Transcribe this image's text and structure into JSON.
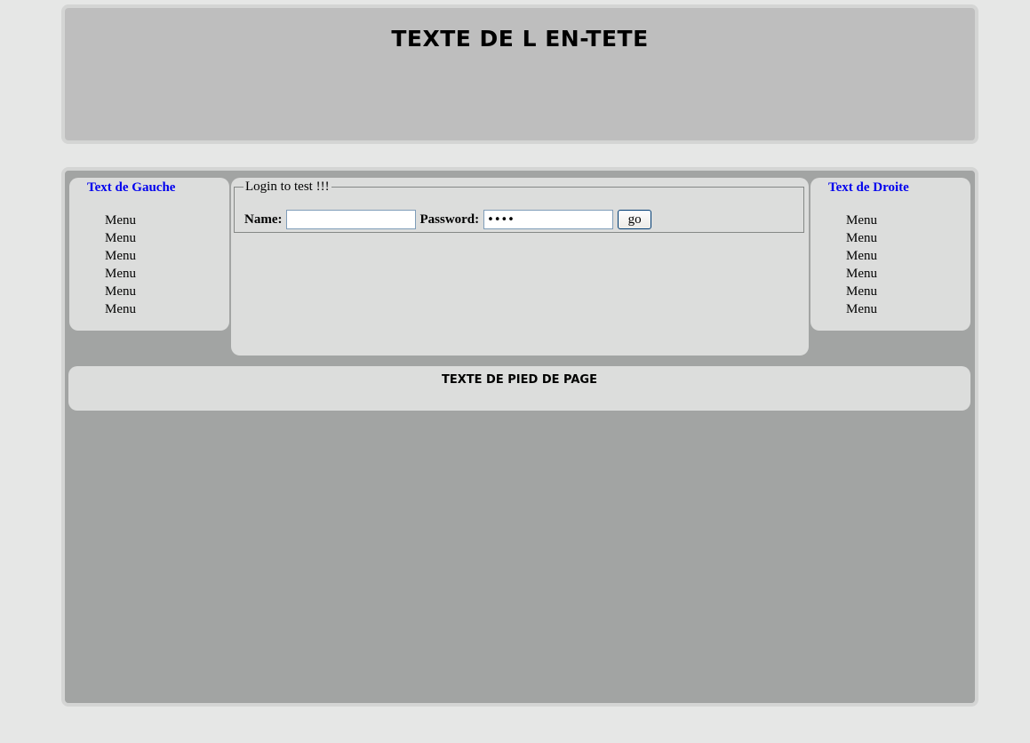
{
  "header": {
    "title": "TEXTE DE L EN-TETE"
  },
  "left_sidebar": {
    "title": "Text de Gauche",
    "items": [
      {
        "label": "Menu"
      },
      {
        "label": "Menu"
      },
      {
        "label": "Menu"
      },
      {
        "label": "Menu"
      },
      {
        "label": "Menu"
      },
      {
        "label": "Menu"
      }
    ]
  },
  "right_sidebar": {
    "title": "Text de Droite",
    "items": [
      {
        "label": "Menu"
      },
      {
        "label": "Menu"
      },
      {
        "label": "Menu"
      },
      {
        "label": "Menu"
      },
      {
        "label": "Menu"
      },
      {
        "label": "Menu"
      }
    ]
  },
  "login": {
    "legend": "Login to test !!!",
    "name_label": "Name:",
    "name_value": "",
    "password_label": "Password:",
    "password_value": "test",
    "go_label": "go"
  },
  "footer": {
    "text": "TEXTE DE PIED DE PAGE"
  },
  "colors": {
    "page_background": "#e6e7e6",
    "header_background": "#bebebe",
    "main_background": "#a2a4a3",
    "panel_background": "#dcdddc",
    "sidebar_title": "#0000ee"
  }
}
